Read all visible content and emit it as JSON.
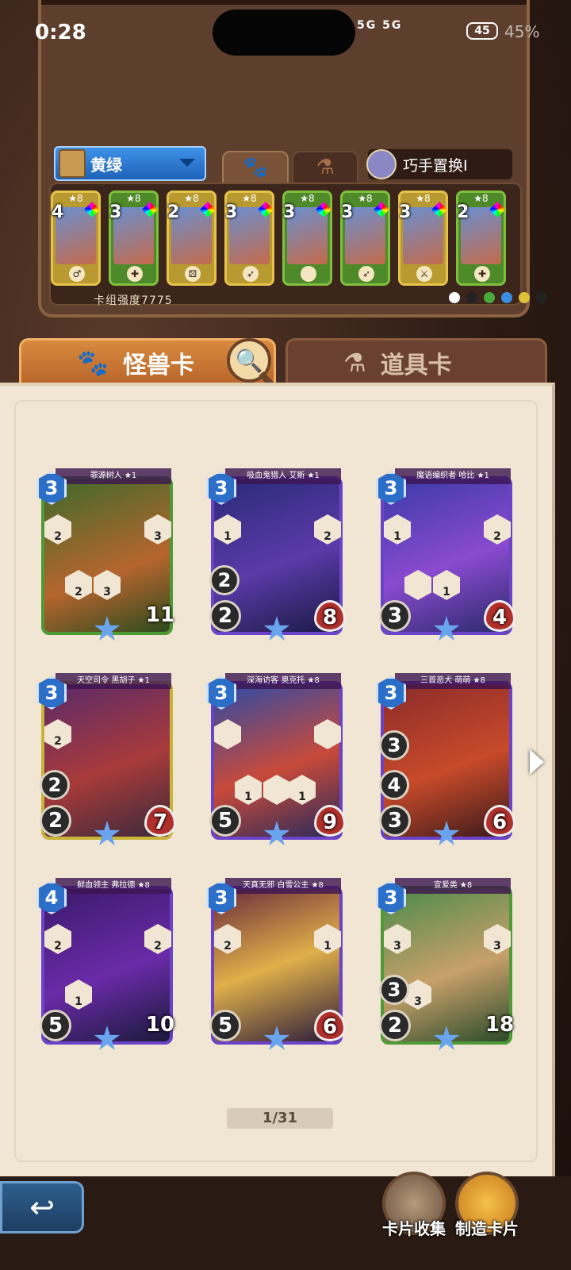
{
  "status_bar": {
    "time": "0:28",
    "signal": "5G 5G",
    "battery": "45",
    "battery_pct": "45%"
  },
  "deck": {
    "name": "黄绿",
    "skill": "巧手置换I",
    "power_label": "卡组强度7775",
    "mini_cards": [
      {
        "cost": "4",
        "level": "★8",
        "role": "♂"
      },
      {
        "cost": "3",
        "level": "★8",
        "role": "✚"
      },
      {
        "cost": "2",
        "level": "★8",
        "role": "⚄"
      },
      {
        "cost": "3",
        "level": "★8",
        "role": "➶"
      },
      {
        "cost": "3",
        "level": "★8",
        "role": ""
      },
      {
        "cost": "3",
        "level": "★8",
        "role": "➶"
      },
      {
        "cost": "3",
        "level": "★8",
        "role": "⚔"
      },
      {
        "cost": "2",
        "level": "★8",
        "role": "✚"
      }
    ],
    "element_colors": [
      "#ffffff",
      "#222222",
      "#49a83a",
      "#3a8fe0",
      "#e0c23a",
      "#222222"
    ]
  },
  "tabs": {
    "monster": "怪兽卡",
    "item": "道具卡"
  },
  "cards": [
    {
      "name": "罪源树人 ★1",
      "cost": "3",
      "atk": "",
      "hp": "11",
      "heart": false,
      "frame": "#4f9a36",
      "art": "linear-gradient(160deg,#3d6a2a,#b6652e 60%,#2d4a1e)",
      "hex": [
        "2",
        "3",
        "2",
        "3"
      ],
      "extra": []
    },
    {
      "name": "吸血鬼猎人 艾斯 ★1",
      "cost": "3",
      "atk": "2",
      "hp": "8",
      "heart": true,
      "frame": "#6b43c8",
      "art": "linear-gradient(160deg,#2a2a78,#5a3aa8 55%,#1a1a44)",
      "hex": [
        "1",
        "2"
      ],
      "extra": [
        "2"
      ]
    },
    {
      "name": "魔语编织者 哈比 ★1",
      "cost": "3",
      "atk": "3",
      "hp": "4",
      "heart": true,
      "frame": "#6b43c8",
      "art": "linear-gradient(160deg,#3a3aa8,#8a4ad0 55%,#2a2a6a)",
      "hex": [
        "1",
        "2",
        "",
        "1"
      ],
      "extra": []
    },
    {
      "name": "天空司令 黑胡子 ★1",
      "cost": "3",
      "atk": "2",
      "hp": "7",
      "heart": true,
      "frame": "#c8b43a",
      "art": "linear-gradient(160deg,#5a2a6a,#a83a3a 55%,#3a2a3a)",
      "hex": [
        "2"
      ],
      "extra": [
        "2"
      ]
    },
    {
      "name": "深海访客 奥克托 ★8",
      "cost": "3",
      "atk": "5",
      "hp": "9",
      "heart": true,
      "frame": "#6b43c8",
      "art": "linear-gradient(160deg,#2a4aa8,#c84a3a 55%,#2a2a5a)",
      "hex": [
        "",
        "",
        "1",
        "",
        "1"
      ],
      "extra": []
    },
    {
      "name": "三首恶犬 萌萌 ★8",
      "cost": "3",
      "atk": "3",
      "hp": "6",
      "heart": true,
      "frame": "#6b43c8",
      "art": "linear-gradient(160deg,#8a2a2a,#c84a2a 55%,#3a1a1a)",
      "hex": [],
      "extra": [
        "4",
        "3"
      ]
    },
    {
      "name": "鲜血领主 弗拉德 ★8",
      "cost": "4",
      "atk": "5",
      "hp": "10",
      "heart": false,
      "frame": "#6b43c8",
      "art": "linear-gradient(160deg,#3a1a6a,#6a2aa8 55%,#1a1a3a)",
      "hex": [
        "2",
        "2",
        "1"
      ],
      "extra": []
    },
    {
      "name": "天真无邪 白雪公主 ★8",
      "cost": "3",
      "atk": "5",
      "hp": "6",
      "heart": true,
      "frame": "#6b43c8",
      "art": "linear-gradient(160deg,#6a2a3a,#e0b04a 50%,#2a1a3a)",
      "hex": [
        "2",
        "1"
      ],
      "extra": []
    },
    {
      "name": "宣爱类 ★8",
      "cost": "3",
      "atk": "2",
      "hp": "18",
      "heart": false,
      "frame": "#4f9a36",
      "art": "linear-gradient(160deg,#4a8a4a,#c8a06a 55%,#2a4a2a)",
      "hex": [
        "3",
        "3",
        "3"
      ],
      "extra": [
        "3"
      ]
    }
  ],
  "pagination": "1/31",
  "bottom_buttons": {
    "collect": "卡片收集",
    "craft": "制造卡片"
  }
}
